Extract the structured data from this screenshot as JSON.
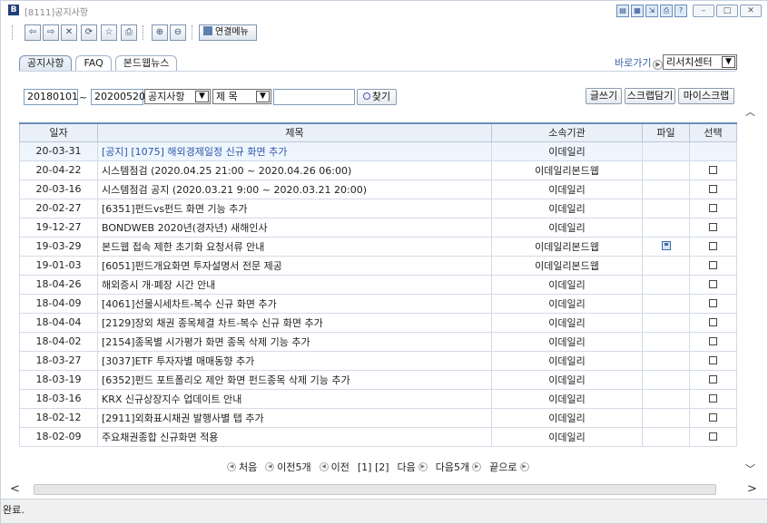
{
  "window": {
    "app_icon": "B",
    "title": "[8111]공지사항",
    "title_buttons": [
      "window-icon",
      "window-icon",
      "window-icon",
      "window-icon",
      "help-icon"
    ],
    "min": "–",
    "max": "□",
    "close": "✕"
  },
  "toolbar": {
    "icons": [
      {
        "name": "back-icon",
        "glyph": "⇦"
      },
      {
        "name": "forward-icon",
        "glyph": "⇨"
      },
      {
        "name": "stop-icon",
        "glyph": "✕"
      },
      {
        "name": "refresh-icon",
        "glyph": "⟳"
      },
      {
        "name": "favorite-icon",
        "glyph": "☆"
      },
      {
        "name": "print-icon",
        "glyph": "⎙"
      },
      {
        "name": "zoom-in-icon",
        "glyph": "⊕"
      },
      {
        "name": "zoom-out-icon",
        "glyph": "⊖"
      }
    ],
    "link_menu": "연결메뉴"
  },
  "tabs": [
    "공지사항",
    "FAQ",
    "본드웹뉴스"
  ],
  "active_tab": 0,
  "goto": {
    "label": "바로가기",
    "value": "리서치센터"
  },
  "filter": {
    "from": "20180101",
    "tilde": "~",
    "to": "20200520",
    "category": "공지사항",
    "field": "제 목",
    "keyword": "",
    "search": "찾기"
  },
  "actions": {
    "write": "글쓰기",
    "scrap": "스크랩담기",
    "my_scrap": "마이스크랩"
  },
  "table": {
    "headers": [
      "일자",
      "제목",
      "소속기관",
      "파일",
      "선택"
    ],
    "rows": [
      {
        "date": "20-03-31",
        "title": "[공지] [1075] 해외경제일정 신규 화면 추가",
        "org": "이데일리",
        "file": false,
        "select": false,
        "highlight": true
      },
      {
        "date": "20-04-22",
        "title": "시스템점검 (2020.04.25 21:00 ~ 2020.04.26 06:00)",
        "org": "이데일리본드웹",
        "file": false,
        "select": true,
        "highlight": false
      },
      {
        "date": "20-03-16",
        "title": "시스템점검 공지 (2020.03.21 9:00 ~ 2020.03.21 20:00)",
        "org": "이데일리",
        "file": false,
        "select": true,
        "highlight": false
      },
      {
        "date": "20-02-27",
        "title": "[6351]펀드vs펀드 화면 기능 추가",
        "org": "이데일리",
        "file": false,
        "select": true,
        "highlight": false
      },
      {
        "date": "19-12-27",
        "title": "BONDWEB 2020년(경자년) 새해인사",
        "org": "이데일리",
        "file": false,
        "select": true,
        "highlight": false
      },
      {
        "date": "19-03-29",
        "title": "본드웹 접속 제한 초기화 요청서류 안내",
        "org": "이데일리본드웹",
        "file": true,
        "select": true,
        "highlight": false
      },
      {
        "date": "19-01-03",
        "title": "[6051]펀드개요화면 투자설명서 전문 제공",
        "org": "이데일리본드웹",
        "file": false,
        "select": true,
        "highlight": false
      },
      {
        "date": "18-04-26",
        "title": "해외증시 개·폐장 시간 안내",
        "org": "이데일리",
        "file": false,
        "select": true,
        "highlight": false
      },
      {
        "date": "18-04-09",
        "title": "[4061]선물시세차트-복수 신규 화면 추가",
        "org": "이데일리",
        "file": false,
        "select": true,
        "highlight": false
      },
      {
        "date": "18-04-04",
        "title": "[2129]장외 채권 종목체결 차트-복수 신규 화면 추가",
        "org": "이데일리",
        "file": false,
        "select": true,
        "highlight": false
      },
      {
        "date": "18-04-02",
        "title": "[2154]종목별 시가평가 화면 종목 삭제 기능 추가",
        "org": "이데일리",
        "file": false,
        "select": true,
        "highlight": false
      },
      {
        "date": "18-03-27",
        "title": "[3037]ETF 투자자별 매매동향 추가",
        "org": "이데일리",
        "file": false,
        "select": true,
        "highlight": false
      },
      {
        "date": "18-03-19",
        "title": "[6352]펀드 포트폴리오 제안 화면 펀드종목 삭제 기능 추가",
        "org": "이데일리",
        "file": false,
        "select": true,
        "highlight": false
      },
      {
        "date": "18-03-16",
        "title": "KRX 신규상장지수 업데이트 안내",
        "org": "이데일리",
        "file": false,
        "select": true,
        "highlight": false
      },
      {
        "date": "18-02-12",
        "title": "[2911]외화표시채권 발행사별 탭 추가",
        "org": "이데일리",
        "file": false,
        "select": true,
        "highlight": false
      },
      {
        "date": "18-02-09",
        "title": "주요채권종합 신규화면 적용",
        "org": "이데일리",
        "file": false,
        "select": true,
        "highlight": false
      }
    ]
  },
  "pager": {
    "first": "처음",
    "prev5": "이전5개",
    "prev": "이전",
    "pages": "[1] [2]",
    "next": "다음",
    "next5": "다음5개",
    "last": "끝으로"
  },
  "scroll": {
    "up": "︿",
    "down": "﹀",
    "left": "<",
    "right": ">"
  },
  "status": "완료."
}
